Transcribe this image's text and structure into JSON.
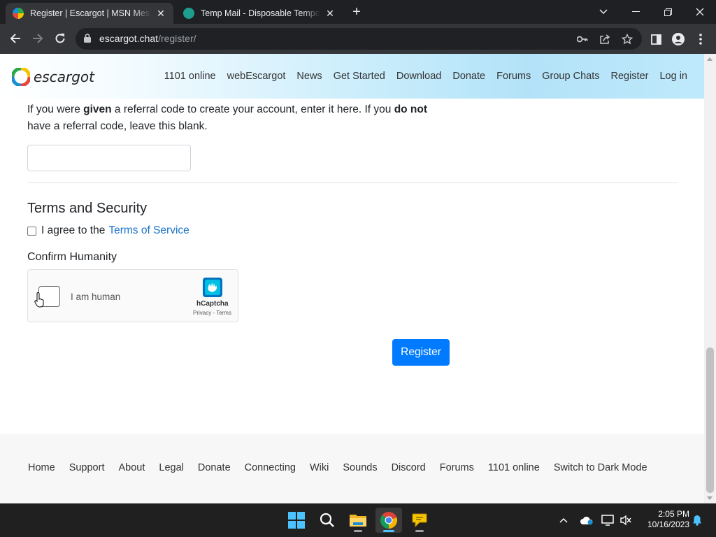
{
  "browser": {
    "tabs": [
      {
        "title": "Register | Escargot | MSN Messe",
        "active": true
      },
      {
        "title": "Temp Mail - Disposable Tempor",
        "active": false
      }
    ],
    "new_tab_icon": "plus-icon",
    "url_host": "escargot.chat",
    "url_path": "/register/"
  },
  "site": {
    "logo_text": "escargot",
    "nav": [
      "1101 online",
      "webEscargot",
      "News",
      "Get Started",
      "Download",
      "Donate",
      "Forums",
      "Group Chats",
      "Register",
      "Log in"
    ]
  },
  "form": {
    "referral_text_1": "If you were ",
    "referral_bold_1": "given",
    "referral_text_2": " a referral code to create your account, enter it here. If you ",
    "referral_bold_2": "do not",
    "referral_text_3": " have a referral code, leave this blank.",
    "referral_value": "",
    "terms_heading": "Terms and Security",
    "agree_text": "I agree to the",
    "terms_link": "Terms of Service",
    "confirm_heading": "Confirm Humanity",
    "captcha_label": "I am human",
    "captcha_brand": "hCaptcha",
    "captcha_links": "Privacy - Terms",
    "register_button": "Register"
  },
  "footer": {
    "links": [
      "Home",
      "Support",
      "About",
      "Legal",
      "Donate",
      "Connecting",
      "Wiki",
      "Sounds",
      "Discord",
      "Forums",
      "1101 online",
      "Switch to Dark Mode"
    ]
  },
  "taskbar": {
    "time": "2:05 PM",
    "date": "10/16/2023"
  },
  "colors": {
    "accent": "#007bff",
    "link": "#1a73c8",
    "header_gradient_end": "#b3e2f8"
  }
}
